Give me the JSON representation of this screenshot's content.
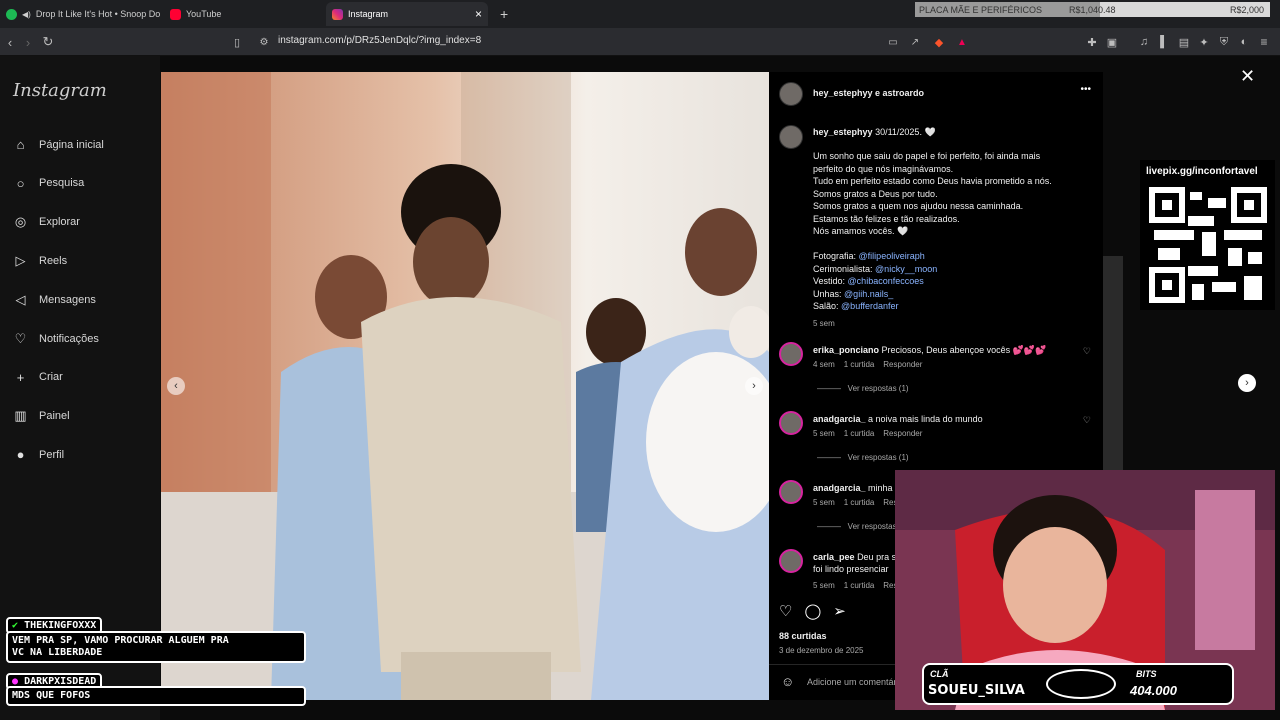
{
  "browser": {
    "tabs": [
      {
        "label": "Drop It Like It's Hot • Snoop Dogg",
        "color": "#1db954"
      },
      {
        "label": "YouTube",
        "color": "#ff0033"
      },
      {
        "label": "Instagram",
        "color": "#e1306c"
      }
    ],
    "close_tab": "×",
    "new_tab": "+",
    "url": "instagram.com/p/DRz5JenDqlc/?img_index=8"
  },
  "stream_goal": {
    "label": "PLACA MÃE E PERIFÉRICOS",
    "current": "R$1,040.48",
    "target": "R$2,000",
    "progress": 0.52
  },
  "instagram": {
    "logo": "Instagram",
    "nav": [
      {
        "label": "Página inicial",
        "icon": "home-icon",
        "glyph": "⌂"
      },
      {
        "label": "Pesquisa",
        "icon": "search-icon",
        "glyph": "○"
      },
      {
        "label": "Explorar",
        "icon": "explore-icon",
        "glyph": "◎"
      },
      {
        "label": "Reels",
        "icon": "reels-icon",
        "glyph": "▷"
      },
      {
        "label": "Mensagens",
        "icon": "messages-icon",
        "glyph": "◁"
      },
      {
        "label": "Notificações",
        "icon": "heart-icon",
        "glyph": "♡"
      },
      {
        "label": "Criar",
        "icon": "plus-icon",
        "glyph": "+"
      },
      {
        "label": "Painel",
        "icon": "dashboard-icon",
        "glyph": "▥"
      },
      {
        "label": "Perfil",
        "icon": "profile-icon",
        "glyph": "●"
      }
    ],
    "post": {
      "header_user": "hey_estephyy e astroardo",
      "more": "•••",
      "caption_user": "hey_estephyy",
      "caption_date": "30/11/2025. 🤍",
      "caption_lines": [
        "Um sonho que saiu do papel e foi perfeito, foi ainda mais",
        "perfeito do que nós imaginávamos.",
        "Tudo em perfeito estado como Deus havia prometido a nós.",
        "Somos gratos a Deus por tudo.",
        "Somos gratos a quem nos ajudou nessa caminhada.",
        "Estamos tão felizes e tão realizados.",
        "Nós amamos vocês. 🤍"
      ],
      "credits": [
        {
          "label": "Fotografia:",
          "handle": "@filipeoliveiraph"
        },
        {
          "label": "Cerimonialista:",
          "handle": "@nicky__moon"
        },
        {
          "label": "Vestido:",
          "handle": "@chibaconfeccoes"
        },
        {
          "label": "Unhas:",
          "handle": "@giih.nails_"
        },
        {
          "label": "Salão:",
          "handle": "@bufferdanfer"
        }
      ],
      "caption_age": "5 sem",
      "comments": [
        {
          "user": "erika_ponciano",
          "text": "Preciosos, Deus abençoe vocês 💕💕💕",
          "age": "4 sem",
          "likes": "1 curtida",
          "reply": "Responder",
          "replies": "Ver respostas (1)"
        },
        {
          "user": "anadgarcia_",
          "text": "a noiva mais linda do mundo",
          "age": "5 sem",
          "likes": "1 curtida",
          "reply": "Responder",
          "replies": "Ver respostas (1)"
        },
        {
          "user": "anadgarcia_",
          "text": "minha",
          "age": "5 sem",
          "likes": "1 curtida",
          "reply": "Resp",
          "replies": "Ver respostas ("
        },
        {
          "user": "carla_pee",
          "text": "Deu pra s",
          "text2": "foi lindo presenciar",
          "age": "5 sem",
          "likes": "1 curtida",
          "reply": "Resp"
        }
      ],
      "likes_count": "88 curtidas",
      "post_date": "3 de dezembro de 2025",
      "add_comment_placeholder": "Adicione um comentário..."
    }
  },
  "overlays": {
    "qr_label": "livepix.gg/inconfortavel",
    "chat": [
      {
        "name": "THEKINGFOXXX",
        "message_lines": [
          "VEM PRA SP, VAMO PROCURAR ALGUEM PRA",
          "VC NA LIBERDADE"
        ]
      },
      {
        "name": "DARKPXISDEAD",
        "message_lines": [
          "MDS QUE FOFOS"
        ]
      }
    ],
    "streamer_plate": {
      "left_tag": "CLÃ",
      "name": "SOUEU_SILVA",
      "right_tag": "BITS",
      "right_value": "404.000"
    }
  }
}
